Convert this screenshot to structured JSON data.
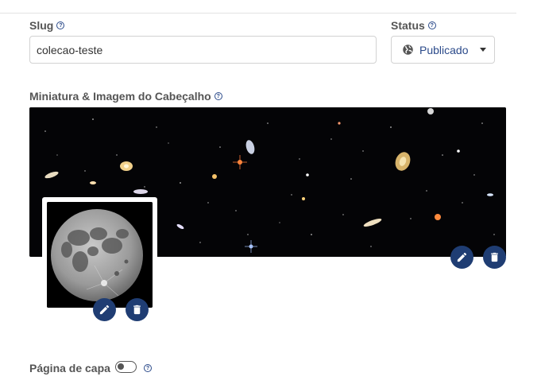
{
  "slug": {
    "label": "Slug",
    "value": "colecao-teste"
  },
  "status": {
    "label": "Status",
    "value": "Publicado"
  },
  "images": {
    "label": "Miniatura & Imagem do Cabeçalho"
  },
  "cover": {
    "label": "Página de capa",
    "enabled": false
  },
  "colors": {
    "accent": "#2b4a8a",
    "button": "#1f3d73"
  }
}
